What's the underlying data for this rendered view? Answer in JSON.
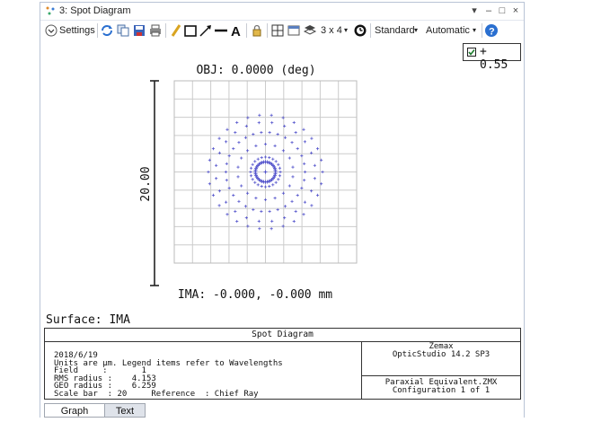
{
  "window": {
    "title": "3: Spot Diagram",
    "controls": [
      "▾",
      "–",
      "□",
      "×"
    ]
  },
  "toolbar": {
    "settings_label": "Settings",
    "layout_label": "3 x 4",
    "standard_label": "Standard",
    "automatic_label": "Automatic",
    "icons": [
      "refresh-icon",
      "copy-icon",
      "save-icon",
      "print-icon",
      "pencil-icon",
      "rectangle-icon",
      "arrow-icon",
      "line-icon",
      "text-icon",
      "lock-icon",
      "grid-icon",
      "window-icon",
      "layers-icon",
      "layout-icon",
      "clock-icon",
      "help-icon"
    ]
  },
  "badge": {
    "value": "+ 0.55"
  },
  "plot": {
    "title": "OBJ: 0.0000 (deg)",
    "scale_label": "20.00",
    "footer": "IMA: -0.000, -0.000 mm",
    "colors": {
      "points": "#5555cc",
      "grid": "#cccccc",
      "frame": "#222222"
    },
    "rings": [
      {
        "count": 24,
        "radius": 1.63
      },
      {
        "count": 18,
        "radius": 3.05
      },
      {
        "count": 30,
        "radius": 4.35
      },
      {
        "count": 24,
        "radius": 5.45
      },
      {
        "count": 30,
        "radius": 6.26
      }
    ],
    "center_ring": {
      "count": 36,
      "radius": 1.1
    }
  },
  "surface_label": "Surface: IMA",
  "info": {
    "header": "Spot Diagram",
    "lines": [
      "2018/6/19",
      "Units are µm. Legend items refer to Wavelengths",
      "Field     :       1",
      "RMS radius :    4.153",
      "GEO radius :    6.259",
      "Scale bar  : 20     Reference  : Chief Ray"
    ],
    "right_top": [
      "Zemax",
      "OpticStudio 14.2 SP3"
    ],
    "right_bottom": [
      "Paraxial Equivalent.ZMX",
      "Configuration 1 of 1"
    ]
  },
  "tabs": [
    {
      "label": "Graph",
      "active": true
    },
    {
      "label": "Text",
      "active": false
    }
  ]
}
